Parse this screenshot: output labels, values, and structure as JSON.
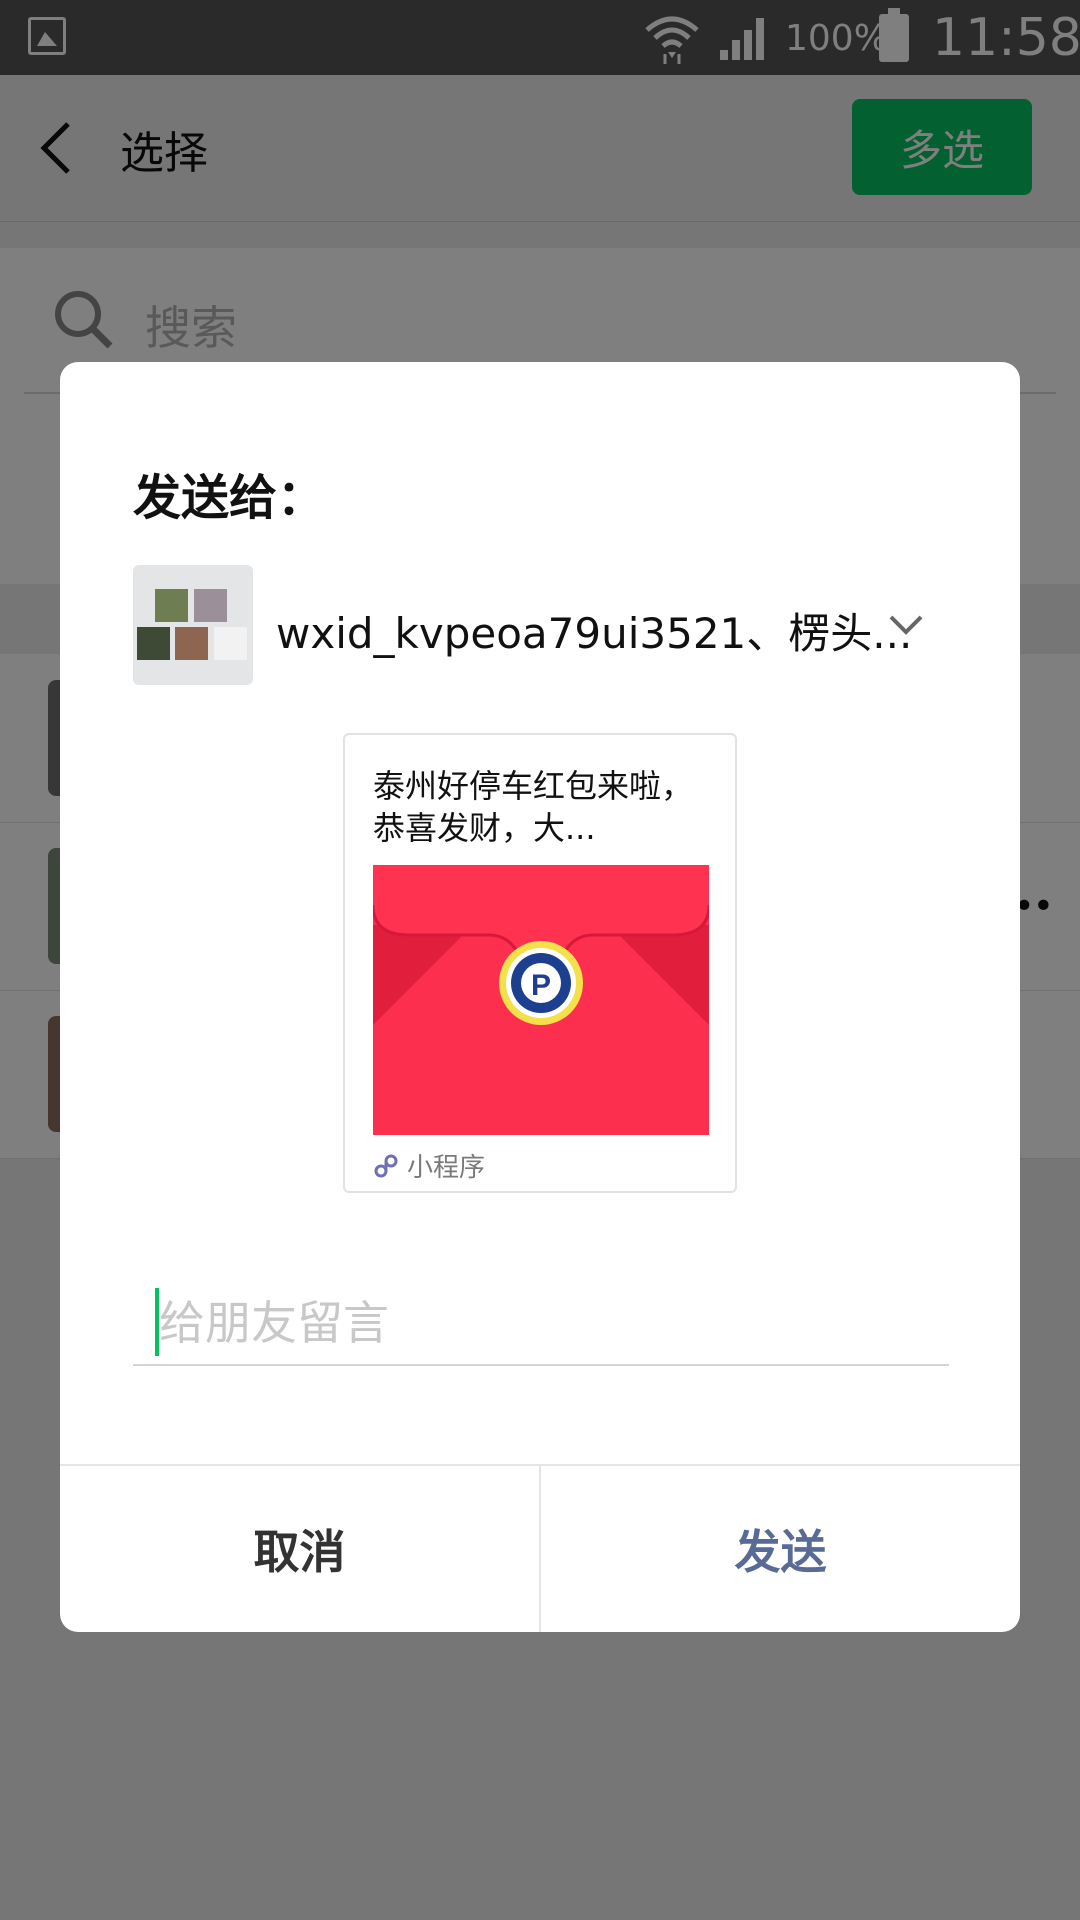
{
  "status_bar": {
    "battery_text": "100%",
    "time": "11:58"
  },
  "header": {
    "title": "选择",
    "multi_select_label": "多选"
  },
  "search": {
    "placeholder": "搜索"
  },
  "dialog": {
    "title": "发送给：",
    "recipient_name": "wxid_kvpeoa79ui3521、楞头...",
    "card": {
      "title": "泰州好停车红包来啦，恭喜发财，大...",
      "footer_label": "小程序"
    },
    "message_placeholder": "给朋友留言",
    "cancel_label": "取消",
    "send_label": "发送"
  },
  "colors": {
    "accent_green": "#07c160",
    "send_blue": "#576b95",
    "red_packet": "#fd2f4e"
  }
}
